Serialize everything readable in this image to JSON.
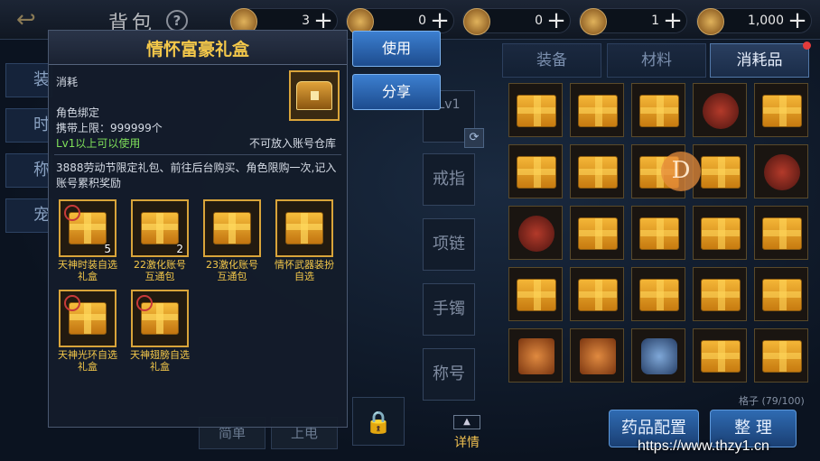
{
  "header": {
    "title": "背包",
    "help": "?",
    "currencies": [
      {
        "icon": "coin-icon",
        "value": "3"
      },
      {
        "icon": "ticket-icon",
        "value": "0"
      },
      {
        "icon": "scroll-icon",
        "value": "0"
      },
      {
        "icon": "gold-coin-icon",
        "value": "1"
      },
      {
        "icon": "bag-coin-icon",
        "value": "1,000"
      }
    ],
    "plus": "+"
  },
  "left_tabs": [
    "装",
    "时",
    "称",
    "宠"
  ],
  "slots": {
    "lv": "Lv1",
    "ring": "戒指",
    "necklace": "项链",
    "bracelet": "手镯",
    "title": "称号",
    "detail": "详情"
  },
  "bottom_left": [
    "简单",
    "上电"
  ],
  "inventory": {
    "tabs": [
      "装备",
      "材料",
      "消耗品"
    ],
    "active_tab": 2,
    "count": "格子 (79/100)",
    "btn_medicine": "药品配置",
    "btn_sort": "整 理",
    "badge": "D"
  },
  "popup": {
    "title": "情怀富豪礼盒",
    "type": "消耗",
    "bind": "角色绑定",
    "limit": "携带上限：999999个",
    "level": "Lv1以上可以使用",
    "storage": "不可放入账号仓库",
    "desc": "3888劳动节限定礼包、前往后台购买、角色限购一次,记入账号累积奖励",
    "rewards": [
      {
        "name": "天神时装自选礼盒",
        "count": "5"
      },
      {
        "name": "22激化账号互通包",
        "count": "2"
      },
      {
        "name": "23激化账号互通包",
        "count": ""
      },
      {
        "name": "情怀武器装扮自选",
        "count": ""
      },
      {
        "name": "天神光环自选礼盒",
        "count": ""
      },
      {
        "name": "天神翅膀自选礼盒",
        "count": ""
      }
    ]
  },
  "actions": {
    "use": "使用",
    "share": "分享"
  },
  "watermark": "https://www.thzy1.cn"
}
